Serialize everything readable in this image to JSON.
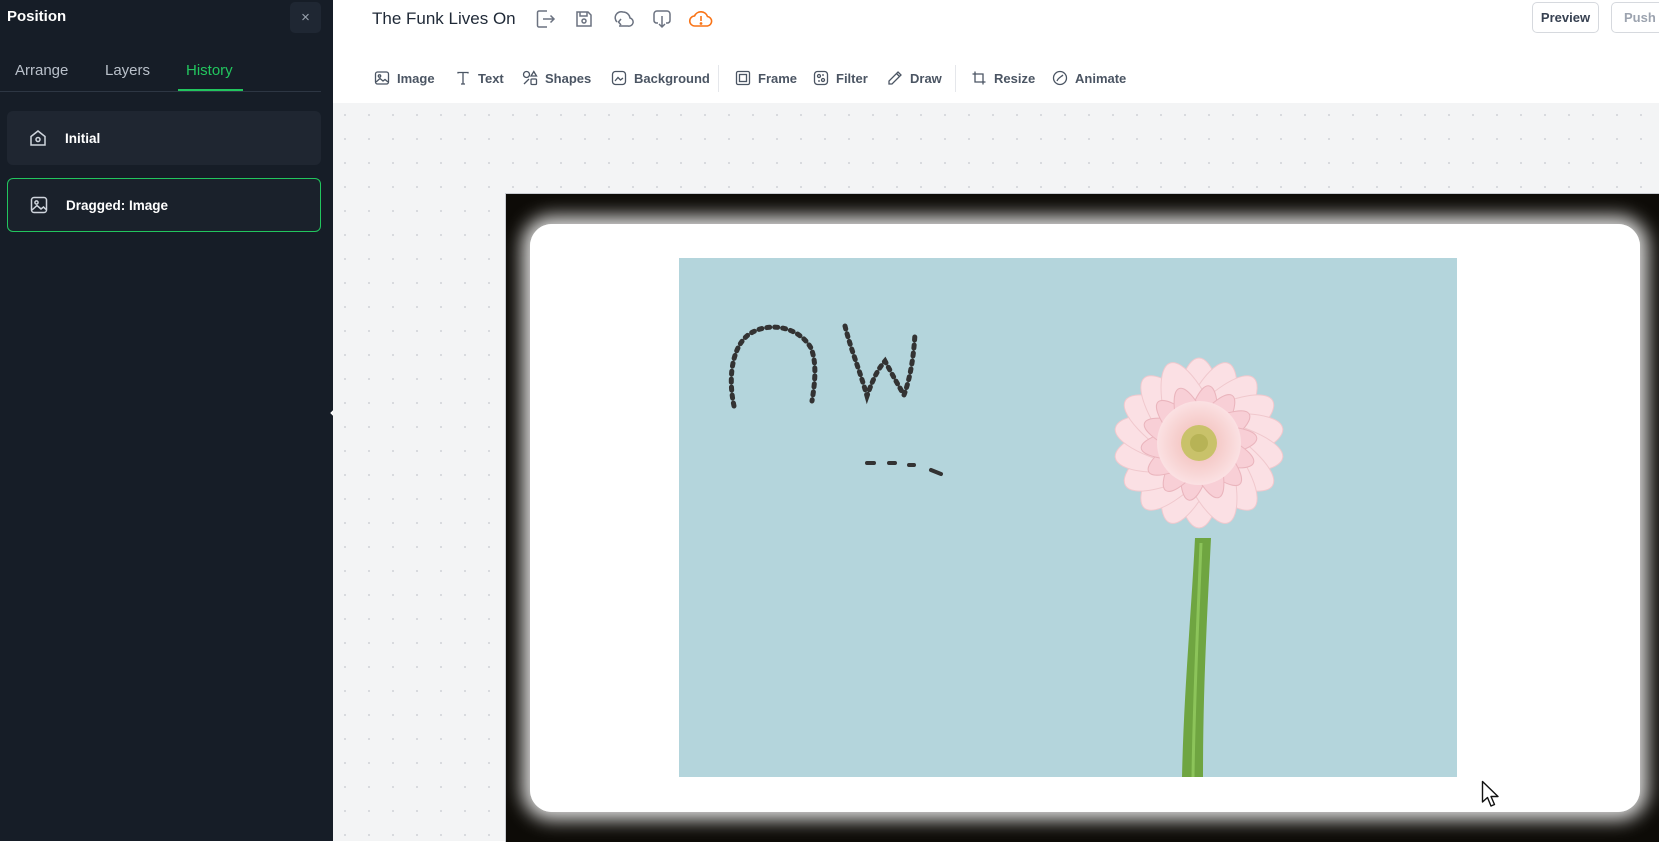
{
  "sidebar": {
    "title": "Position",
    "close_label": "×",
    "tabs": [
      {
        "label": "Arrange",
        "active": false
      },
      {
        "label": "Layers",
        "active": false
      },
      {
        "label": "History",
        "active": true
      }
    ],
    "history": [
      {
        "label": "Initial",
        "icon": "home-icon",
        "selected": false
      },
      {
        "label": "Dragged: Image",
        "icon": "image-icon",
        "selected": true
      }
    ]
  },
  "header": {
    "doc_title": "The Funk Lives On",
    "icons": [
      "export-icon",
      "save-icon",
      "sync-icon",
      "download-icon",
      "cloud-warning-icon"
    ],
    "preview_label": "Preview",
    "push_label": "Push to"
  },
  "toolbar": {
    "tools": [
      {
        "label": "Image",
        "icon": "image-icon"
      },
      {
        "label": "Text",
        "icon": "text-icon"
      },
      {
        "label": "Shapes",
        "icon": "shapes-icon"
      },
      {
        "label": "Background",
        "icon": "background-icon"
      },
      {
        "label": "Frame",
        "icon": "frame-icon"
      },
      {
        "label": "Filter",
        "icon": "filter-icon"
      },
      {
        "label": "Draw",
        "icon": "pencil-icon"
      },
      {
        "label": "Resize",
        "icon": "resize-icon"
      },
      {
        "label": "Animate",
        "icon": "animate-icon"
      }
    ]
  },
  "colors": {
    "accent": "#22c55e",
    "sidebar_bg": "#161d27",
    "warning": "#f97316",
    "photo_bg": "#b4d5dc"
  }
}
